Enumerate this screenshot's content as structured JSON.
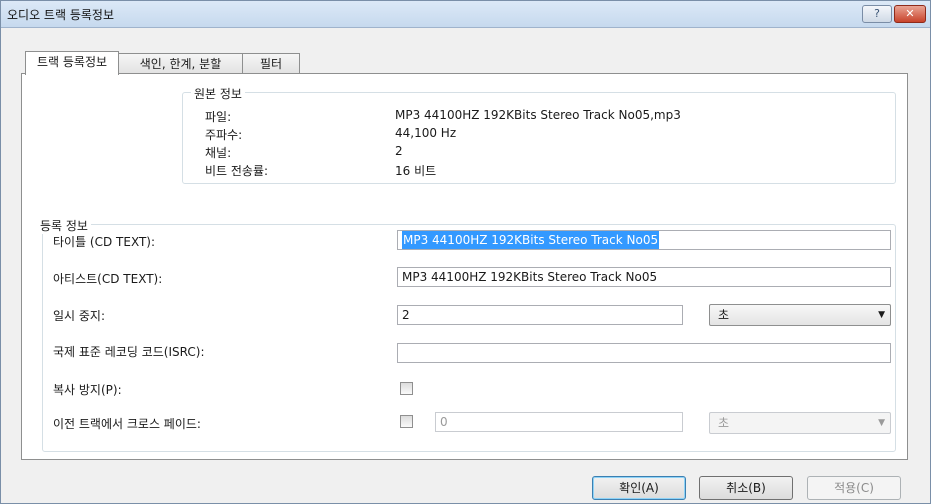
{
  "window": {
    "title": "오디오 트랙 등록정보",
    "help_glyph": "?",
    "close_glyph": "✕"
  },
  "tabs": [
    {
      "label": "트랙 등록정보",
      "active": true
    },
    {
      "label": "색인, 한계, 분할",
      "active": false
    },
    {
      "label": "필터",
      "active": false
    }
  ],
  "source": {
    "group_label": "원본 정보",
    "rows": [
      {
        "label": "파일:",
        "value": "MP3 44100HZ 192KBits Stereo Track No05,mp3"
      },
      {
        "label": "주파수:",
        "value": "44,100 Hz"
      },
      {
        "label": "채널:",
        "value": "2"
      },
      {
        "label": "비트 전송률:",
        "value": "16 비트"
      }
    ]
  },
  "registration": {
    "group_label": "등록 정보",
    "title_label": "타이틀 (CD TEXT):",
    "title_value": "MP3 44100HZ 192KBits Stereo Track No05",
    "artist_label": "아티스트(CD TEXT):",
    "artist_value": "MP3 44100HZ 192KBits Stereo Track No05",
    "pause_label": "일시 중지:",
    "pause_value": "2",
    "pause_unit": "초",
    "isrc_label": "국제 표준 레코딩 코드(ISRC):",
    "isrc_value": "",
    "copy_protect_label": "복사 방지(P):",
    "copy_protect_checked": false,
    "crossfade_label": "이전 트랙에서 크로스 페이드:",
    "crossfade_checked": false,
    "crossfade_value": "0",
    "crossfade_unit": "초"
  },
  "buttons": {
    "ok": "확인(A)",
    "cancel": "취소(B)",
    "apply": "적용(C)"
  },
  "colors": {
    "selection": "#3399ff",
    "title_bar": "#c6d9ee",
    "close_button": "#c8432b"
  }
}
